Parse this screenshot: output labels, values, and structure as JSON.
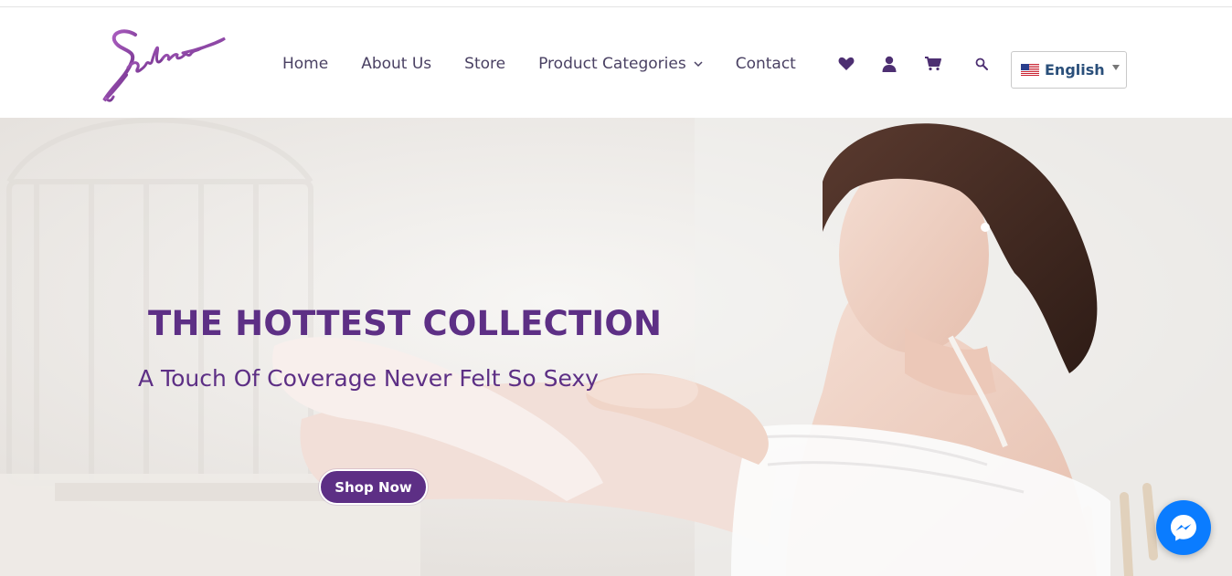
{
  "header": {
    "logo_alt": "Sabina",
    "nav": [
      {
        "label": "Home"
      },
      {
        "label": "About Us"
      },
      {
        "label": "Store"
      },
      {
        "label": "Product Categories",
        "has_dropdown": true
      },
      {
        "label": "Contact"
      }
    ],
    "icons": [
      "heart-icon",
      "user-icon",
      "cart-icon",
      "search-icon"
    ],
    "language": {
      "label": "English",
      "flag": "us-flag"
    }
  },
  "hero": {
    "title": "THE HOTTEST COLLECTION",
    "subtitle": "A Touch Of Coverage Never Felt So Sexy",
    "cta_label": "Shop Now"
  },
  "colors": {
    "brand_purple": "#5d2f85",
    "nav_text": "#4a4163",
    "messenger_blue": "#0a7cff"
  }
}
